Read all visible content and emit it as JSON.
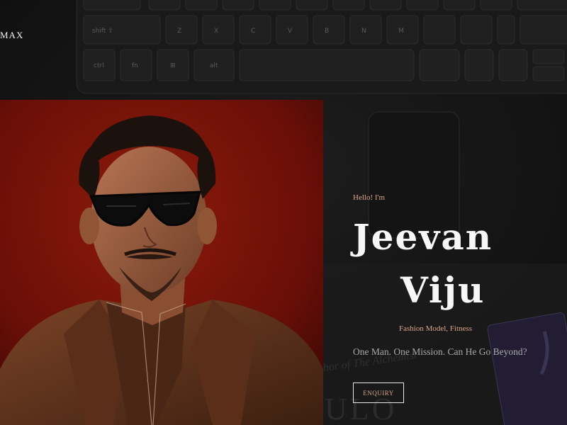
{
  "brand": {
    "text": "MAX"
  },
  "hero": {
    "greeting": "Hello! I'm",
    "first_name": "Jeevan",
    "last_name": "Viju",
    "role": "Fashion Model, Fitness",
    "tagline": "One Man. One Mission. Can He Go Beyond?",
    "enquiry_label": "ENQUIRY"
  },
  "background": {
    "book_text": "thor of The Alchemist",
    "book_large_text": "ULO"
  },
  "colors": {
    "background": "#161616",
    "accent": "#d9a58a",
    "photo_backdrop": "#7a1208",
    "heading": "#f7f7f7"
  }
}
